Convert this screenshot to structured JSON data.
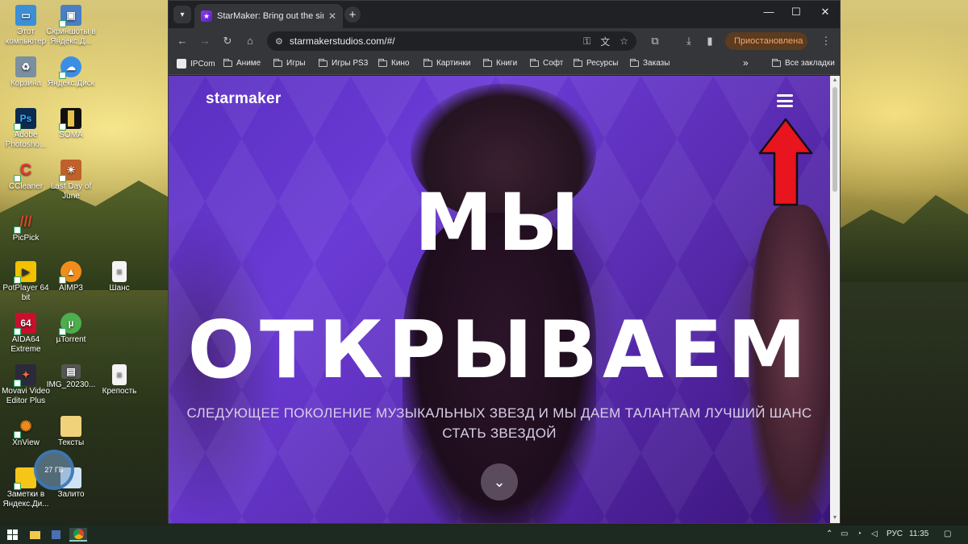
{
  "desktop": {
    "icons": [
      {
        "label": "Этот компьютер"
      },
      {
        "label": "Скриншоты в Яндекс.Д..."
      },
      {
        "label": "Корзина"
      },
      {
        "label": "Яндекс.Диск"
      },
      {
        "label": "Adobe Photosho..."
      },
      {
        "label": "SOMA"
      },
      {
        "label": "CCleaner"
      },
      {
        "label": "Last Day of June"
      },
      {
        "label": "PicPick"
      },
      {
        "label": "PotPlayer 64 bit"
      },
      {
        "label": "AIMP3"
      },
      {
        "label": "Шанс"
      },
      {
        "label": "AIDA64 Extreme"
      },
      {
        "label": "µTorrent"
      },
      {
        "label": "Movavi Video Editor Plus"
      },
      {
        "label": "IMG_20230..."
      },
      {
        "label": "Крепость"
      },
      {
        "label": "XnView"
      },
      {
        "label": "Тексты"
      },
      {
        "label": "Заметки в Яндекс.Ди..."
      },
      {
        "label": "Залито"
      }
    ],
    "disk_widget": "27 ГБ"
  },
  "browser": {
    "tab_title": "StarMaker: Bring out the singer",
    "tab_close": "✕",
    "new_tab": "+",
    "url": "starmakerstudios.com/#/",
    "profile_status": "Приостановлена",
    "bookmarks": [
      {
        "label": "IPCom"
      },
      {
        "label": "Аниме"
      },
      {
        "label": "Игры"
      },
      {
        "label": "Игры PS3"
      },
      {
        "label": "Кино"
      },
      {
        "label": "Картинки"
      },
      {
        "label": "Книги"
      },
      {
        "label": "Софт"
      },
      {
        "label": "Ресурсы"
      },
      {
        "label": "Заказы"
      },
      {
        "label": "Все закладки"
      }
    ],
    "more_bookmarks": "»"
  },
  "page": {
    "logo": "starmaker",
    "headline_line1": "МЫ",
    "headline_line2": "ОТКРЫВАЕМ",
    "subtitle_line1": "СЛЕДУЮЩЕЕ ПОКОЛЕНИЕ МУЗЫКАЛЬНЫХ ЗВЕЗД И МЫ ДАЕМ ТАЛАНТАМ ЛУЧШИЙ ШАНС",
    "subtitle_line2": "СТАТЬ ЗВЕЗДОЙ",
    "arrow_color": "#e8141e",
    "brand_color": "#5a2fc0"
  },
  "taskbar": {
    "language": "РУС",
    "time": "11:35"
  }
}
